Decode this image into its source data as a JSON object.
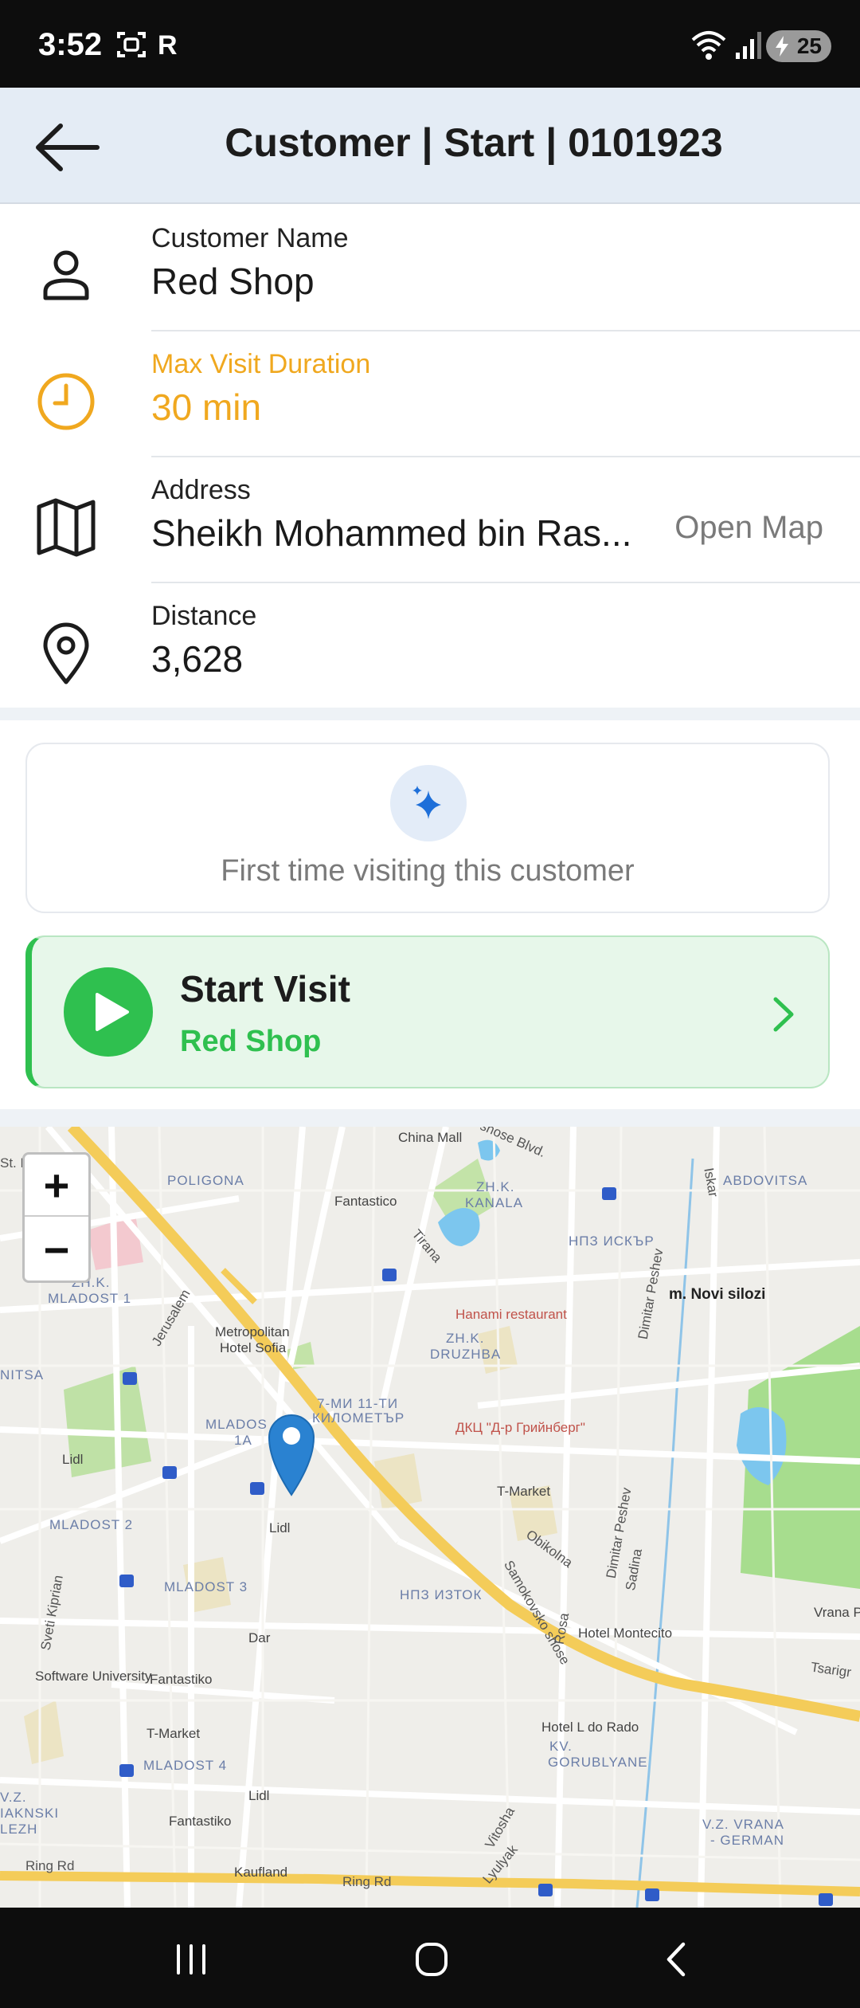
{
  "status_bar": {
    "time": "3:52",
    "battery": "25",
    "icons": [
      "screenshot-icon",
      "r-icon",
      "wifi-icon",
      "signal-icon",
      "battery-icon"
    ]
  },
  "header": {
    "title": "Customer | Start | 0101923",
    "back_icon": "arrow-left-icon"
  },
  "info_rows": {
    "customer": {
      "label": "Customer Name",
      "value": "Red Shop",
      "icon": "person-icon"
    },
    "duration": {
      "label": "Max Visit Duration",
      "value": "30 min",
      "icon": "clock-icon",
      "color": "#f0a81f"
    },
    "address": {
      "label": "Address",
      "value": "Sheikh Mohammed bin Ras...",
      "action": "Open Map",
      "icon": "map-icon"
    },
    "distance": {
      "label": "Distance",
      "value": "3,628",
      "icon": "location-pin-icon"
    }
  },
  "first_time": {
    "message": "First time visiting this customer",
    "icon": "sparkle-icon"
  },
  "start_visit": {
    "title": "Start Visit",
    "subtitle": "Red Shop",
    "icon": "play-icon",
    "accent": "#2fc04f"
  },
  "map": {
    "zoom_in": "+",
    "zoom_out": "−",
    "labels": {
      "china_mall": "China Mall",
      "shose_blvd": "shose Blvd.",
      "poligona": "POLIGONA",
      "fantastico1": "Fantastico",
      "zhk_kanala_1": "ZH.K.",
      "zhk_kanala_2": "KANALA",
      "iskar": "Iskar",
      "abdovitsa": "ABDOVITSA",
      "nps_iskar": "НПЗ ИСКЪР",
      "zhk_mladost1_1": "ZH.K.",
      "zhk_mladost1_2": "MLADOST 1",
      "jerusalem": "Jerusalem",
      "tirana": "Tirana",
      "hanami": "Hanami restaurant",
      "dimitar_peshev": "Dimitar Peshev",
      "novi_silozi": "m. Novi silozi",
      "metropolitan_1": "Metropolitan",
      "metropolitan_2": "Hotel Sofia",
      "zhk_druzhba_1": "ZH.K.",
      "zhk_druzhba_2": "DRUZHBA",
      "nitsa": "NITSA",
      "mi_11_1": "7-МИ 11-ТИ",
      "mi_11_2": "КИЛОМЕТЪР",
      "mladost_1a_1": "MLADOS",
      "mladost_1a_2": "1A",
      "dkc": "ДКЦ \"Д-р Грийнберг\"",
      "lidl1": "Lidl",
      "t_market1": "T-Market",
      "lidl2": "Lidl",
      "mladost2": "MLADOST 2",
      "obikolna": "Obikolna",
      "dimitar_peshev2": "Dimitar Peshev",
      "sadina": "Sadina",
      "sveti_kiril": "Sveti Kiprian",
      "mladost3": "MLADOST 3",
      "npz_iztok": "НПЗ ИЗТОК",
      "samokovsko": "Samokovsko shose",
      "rosa": "Rosa",
      "hotel_montecito": "Hotel Montecito",
      "tsarigrad": "Tsarigr",
      "vrana_p": "Vrana P",
      "dar": "Dar",
      "software_university": "Software University",
      "fantastico2": "Fantastiko",
      "t_market2": "T-Market",
      "hotel_lrado": "Hotel L do Rado",
      "kv_gorublyane_1": "KV.",
      "kv_gorublyane_2": "GORUBLYANE",
      "mladost4": "MLADOST 4",
      "lidl3": "Lidl",
      "vitosha": "Vitosha",
      "lyulyak": "Lyulyak",
      "vz_vrana_1": "V.Z. VRANA",
      "vz_vrana_2": "- GERMAN",
      "iakniski": "IAKNSKI",
      "lezh": "LEZH",
      "vz": "V.Z.",
      "fantastiko3": "Fantastiko",
      "ring_rd1": "Ring Rd",
      "kaufland": "Kaufland",
      "ring_rd2": "Ring Rd",
      "st_n": "St. N"
    }
  },
  "nav_bar": {
    "icons": [
      "recent-apps-icon",
      "home-icon",
      "back-icon"
    ]
  }
}
